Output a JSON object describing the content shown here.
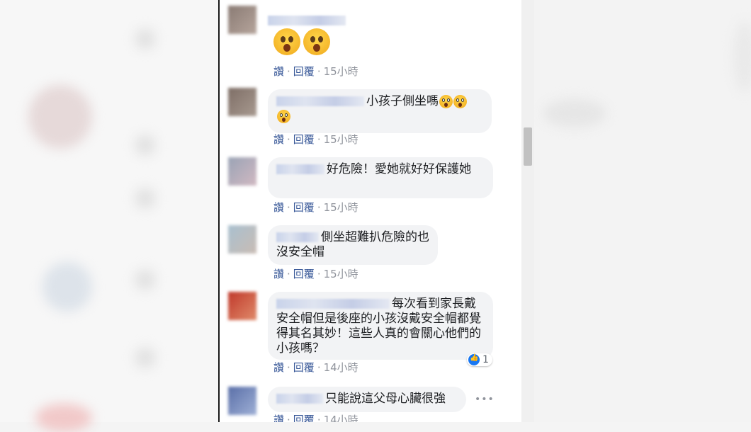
{
  "actions": {
    "like": "讚",
    "reply": "回覆",
    "separator": "·"
  },
  "comments": [
    {
      "text": "",
      "time": "15小時"
    },
    {
      "text": "小孩子側坐嗎",
      "time": "15小時"
    },
    {
      "text": "好危險！愛她就好好保護她",
      "time": "15小時"
    },
    {
      "text": "側坐超難扒危險的也沒安全帽",
      "time": "15小時"
    },
    {
      "text": "每次看到家長戴安全帽但是後座的小孩沒戴安全帽都覺得其名其妙！這些人真的會關心他們的小孩嗎？",
      "time": "14小時",
      "reactions": "1"
    },
    {
      "text": "只能說這父母心臟很強",
      "time": "14小時"
    }
  ],
  "colors": {
    "link": "#385898",
    "bubble": "#f2f3f5",
    "like": "#1877f2"
  }
}
